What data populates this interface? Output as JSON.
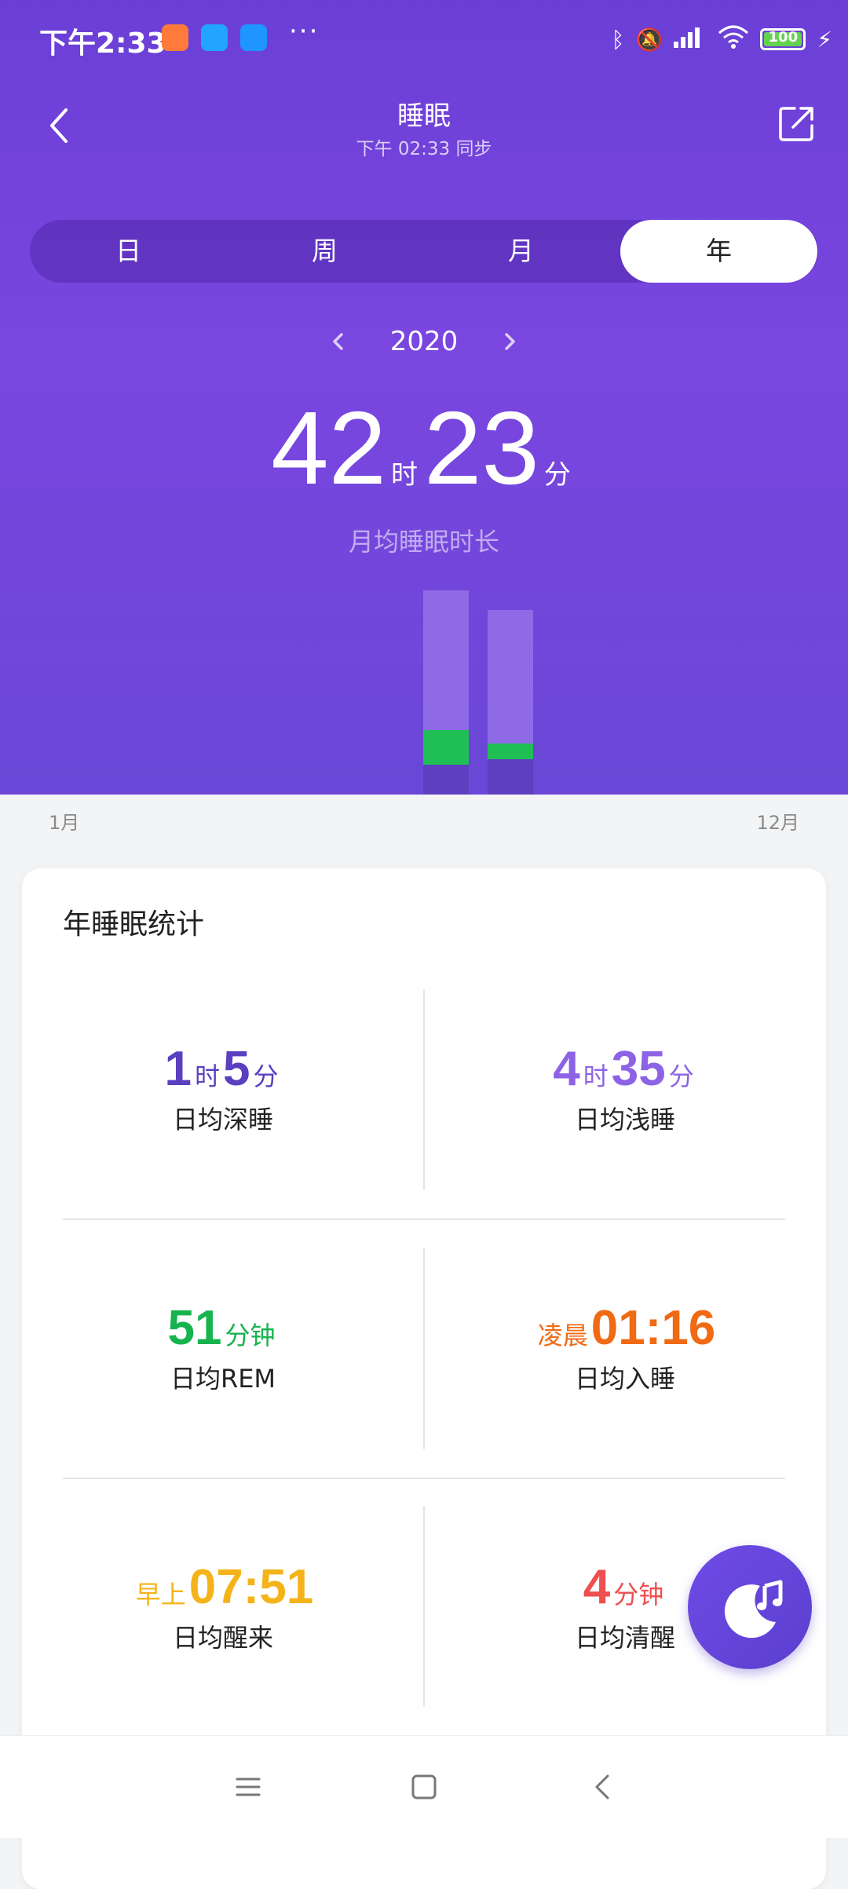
{
  "status_bar": {
    "time": "下午2:33",
    "battery": "100",
    "icons": [
      "bluetooth-icon",
      "mute-icon",
      "signal-icon",
      "wifi-icon",
      "battery-icon",
      "charging-icon"
    ]
  },
  "header": {
    "title": "睡眠",
    "sync": "下午 02:33 同步"
  },
  "tabs": [
    "日",
    "周",
    "月",
    "年"
  ],
  "active_tab": "年",
  "year": "2020",
  "summary": {
    "hours": "42",
    "hours_unit": "时",
    "minutes": "23",
    "minutes_unit": "分",
    "label": "月均睡眠时长"
  },
  "chart_data": {
    "type": "bar",
    "stacked": true,
    "x_start_label": "1月",
    "x_end_label": "12月",
    "colors": {
      "light_sleep": "#8f6ae6",
      "deep_sleep": "#5e3fc0",
      "rem": "#1fbf55"
    }
  },
  "stats": {
    "title": "年睡眠统计",
    "items": [
      {
        "num1": "1",
        "unit1": "时",
        "num2": "5",
        "unit2": "分",
        "label": "日均深睡",
        "color": "#5a3fc0"
      },
      {
        "num1": "4",
        "unit1": "时",
        "num2": "35",
        "unit2": "分",
        "label": "日均浅睡",
        "color": "#8d63e6"
      },
      {
        "num1": "51",
        "unit1": "分钟",
        "label": "日均REM",
        "color": "#17b34f"
      },
      {
        "prefix": "凌晨",
        "time": "01:16",
        "label": "日均入睡",
        "color": "#f06a14"
      },
      {
        "prefix": "早上",
        "time": "07:51",
        "label": "日均醒来",
        "color": "#f5b31a"
      },
      {
        "num1": "4",
        "unit1": "分钟",
        "label": "日均清醒",
        "color": "#ee4f4f"
      }
    ]
  }
}
